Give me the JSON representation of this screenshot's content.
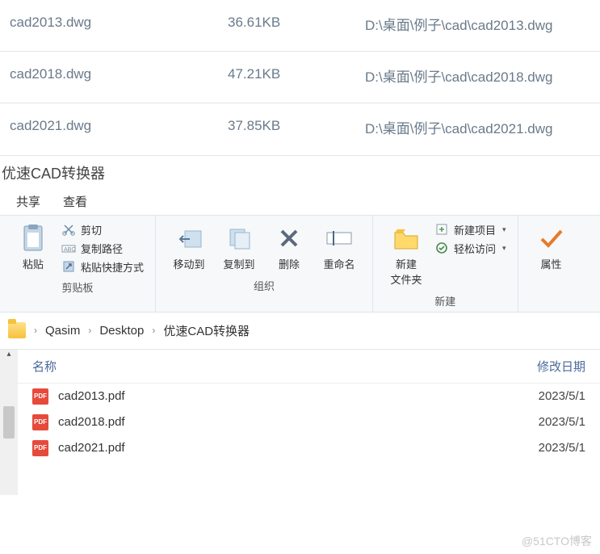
{
  "app_title": "优速CAD转换器",
  "source_files": [
    {
      "name": "cad2013.dwg",
      "size": "36.61KB",
      "path": "D:\\桌面\\例子\\cad\\cad2013.dwg"
    },
    {
      "name": "cad2018.dwg",
      "size": "47.21KB",
      "path": "D:\\桌面\\例子\\cad\\cad2018.dwg"
    },
    {
      "name": "cad2021.dwg",
      "size": "37.85KB",
      "path": "D:\\桌面\\例子\\cad\\cad2021.dwg"
    }
  ],
  "tabs": {
    "share": "共享",
    "view": "查看"
  },
  "ribbon": {
    "clipboard": {
      "paste": "粘贴",
      "cut": "剪切",
      "copy_path": "复制路径",
      "paste_shortcut": "粘贴快捷方式",
      "label": "剪贴板"
    },
    "organize": {
      "move_to": "移动到",
      "copy_to": "复制到",
      "delete": "删除",
      "rename": "重命名",
      "label": "组织"
    },
    "new": {
      "new_folder": "新建\n文件夹",
      "new_item": "新建项目",
      "easy_access": "轻松访问",
      "label": "新建"
    },
    "properties": "属性"
  },
  "breadcrumb": [
    "Qasim",
    "Desktop",
    "优速CAD转换器"
  ],
  "explorer": {
    "col_name": "名称",
    "col_date": "修改日期",
    "files": [
      {
        "name": "cad2013.pdf",
        "date": "2023/5/1"
      },
      {
        "name": "cad2018.pdf",
        "date": "2023/5/1"
      },
      {
        "name": "cad2021.pdf",
        "date": "2023/5/1"
      }
    ]
  },
  "watermark": "@51CTO博客"
}
